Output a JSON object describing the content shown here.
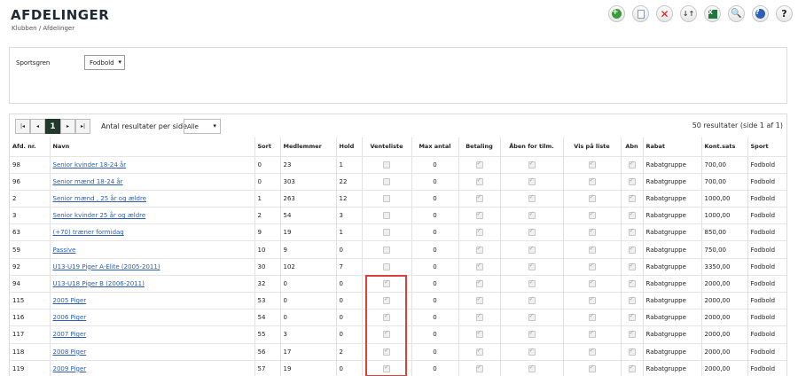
{
  "header": {
    "title": "AFDELINGER",
    "breadcrumb": "Klubben / Afdelinger"
  },
  "toolbar": [
    {
      "name": "add-icon",
      "glyph": "+"
    },
    {
      "name": "document-icon",
      "glyph": ""
    },
    {
      "name": "delete-icon",
      "glyph": "✕"
    },
    {
      "name": "sort-icon",
      "glyph": "↓↑"
    },
    {
      "name": "excel-icon",
      "glyph": "X"
    },
    {
      "name": "search-icon",
      "glyph": "🔍"
    },
    {
      "name": "info-icon",
      "glyph": "?"
    },
    {
      "name": "help-icon",
      "glyph": "?"
    }
  ],
  "filter": {
    "label": "Sportsgren",
    "value": "Fodbold"
  },
  "pager": {
    "first": "|◂",
    "prev": "◂",
    "current": "1",
    "next": "▸",
    "last": "▸|",
    "per_page_label": "Antal resultater per side",
    "per_page_value": "Alle",
    "result_count": "50 resultater (side 1 af 1)"
  },
  "table": {
    "columns": [
      "Afd. nr.",
      "Navn",
      "Sort",
      "Medlemmer",
      "Hold",
      "Venteliste",
      "Max antal",
      "Betaling",
      "Åben for tilm.",
      "Vis på liste",
      "Abn",
      "Rabat",
      "Kont.sats",
      "Sport"
    ],
    "rows": [
      {
        "nr": "98",
        "navn": "Senior kvinder 18-24 år",
        "sort": "0",
        "medlemmer": "23",
        "hold": "1",
        "venteliste": false,
        "max": "0",
        "betaling": true,
        "aaben": true,
        "vis": true,
        "abn": true,
        "rabat": "Rabatgruppe",
        "sats": "700,00",
        "sport": "Fodbold"
      },
      {
        "nr": "96",
        "navn": "Senior mænd 18-24 år",
        "sort": "0",
        "medlemmer": "303",
        "hold": "22",
        "venteliste": false,
        "max": "0",
        "betaling": true,
        "aaben": true,
        "vis": true,
        "abn": true,
        "rabat": "Rabatgruppe",
        "sats": "700,00",
        "sport": "Fodbold"
      },
      {
        "nr": "2",
        "navn": "Senior mænd , 25 år og ældre",
        "sort": "1",
        "medlemmer": "263",
        "hold": "12",
        "venteliste": false,
        "max": "0",
        "betaling": true,
        "aaben": true,
        "vis": true,
        "abn": true,
        "rabat": "Rabatgruppe",
        "sats": "1000,00",
        "sport": "Fodbold"
      },
      {
        "nr": "3",
        "navn": "Senior kvinder 25 år og ældre",
        "sort": "2",
        "medlemmer": "54",
        "hold": "3",
        "venteliste": false,
        "max": "0",
        "betaling": true,
        "aaben": true,
        "vis": true,
        "abn": true,
        "rabat": "Rabatgruppe",
        "sats": "1000,00",
        "sport": "Fodbold"
      },
      {
        "nr": "63",
        "navn": "(+70) træner formidag",
        "sort": "9",
        "medlemmer": "19",
        "hold": "1",
        "venteliste": false,
        "max": "0",
        "betaling": true,
        "aaben": true,
        "vis": true,
        "abn": true,
        "rabat": "Rabatgruppe",
        "sats": "850,00",
        "sport": "Fodbold"
      },
      {
        "nr": "59",
        "navn": "Passive",
        "sort": "10",
        "medlemmer": "9",
        "hold": "0",
        "venteliste": false,
        "max": "0",
        "betaling": true,
        "aaben": true,
        "vis": true,
        "abn": true,
        "rabat": "Rabatgruppe",
        "sats": "750,00",
        "sport": "Fodbold"
      },
      {
        "nr": "92",
        "navn": "U13-U19 Piger A-Elite (2005-2011)",
        "sort": "30",
        "medlemmer": "102",
        "hold": "7",
        "venteliste": false,
        "max": "0",
        "betaling": true,
        "aaben": true,
        "vis": true,
        "abn": true,
        "rabat": "Rabatgruppe",
        "sats": "3350,00",
        "sport": "Fodbold"
      },
      {
        "nr": "94",
        "navn": "U13-U18 Piger B (2006-2011)",
        "sort": "32",
        "medlemmer": "0",
        "hold": "0",
        "venteliste": true,
        "max": "0",
        "betaling": true,
        "aaben": true,
        "vis": true,
        "abn": true,
        "rabat": "Rabatgruppe",
        "sats": "2000,00",
        "sport": "Fodbold"
      },
      {
        "nr": "115",
        "navn": "2005 Piger",
        "sort": "53",
        "medlemmer": "0",
        "hold": "0",
        "venteliste": true,
        "max": "0",
        "betaling": true,
        "aaben": true,
        "vis": true,
        "abn": true,
        "rabat": "Rabatgruppe",
        "sats": "2000,00",
        "sport": "Fodbold"
      },
      {
        "nr": "116",
        "navn": "2006 Piger",
        "sort": "54",
        "medlemmer": "0",
        "hold": "0",
        "venteliste": true,
        "max": "0",
        "betaling": true,
        "aaben": true,
        "vis": true,
        "abn": true,
        "rabat": "Rabatgruppe",
        "sats": "2000,00",
        "sport": "Fodbold"
      },
      {
        "nr": "117",
        "navn": "2007 Piger",
        "sort": "55",
        "medlemmer": "3",
        "hold": "0",
        "venteliste": true,
        "max": "0",
        "betaling": true,
        "aaben": true,
        "vis": true,
        "abn": true,
        "rabat": "Rabatgruppe",
        "sats": "2000,00",
        "sport": "Fodbold"
      },
      {
        "nr": "118",
        "navn": "2008 Piger",
        "sort": "56",
        "medlemmer": "17",
        "hold": "2",
        "venteliste": true,
        "max": "0",
        "betaling": true,
        "aaben": true,
        "vis": true,
        "abn": true,
        "rabat": "Rabatgruppe",
        "sats": "2000,00",
        "sport": "Fodbold"
      },
      {
        "nr": "119",
        "navn": "2009 Piger",
        "sort": "57",
        "medlemmer": "19",
        "hold": "0",
        "venteliste": true,
        "max": "0",
        "betaling": true,
        "aaben": true,
        "vis": true,
        "abn": true,
        "rabat": "Rabatgruppe",
        "sats": "2000,00",
        "sport": "Fodbold"
      }
    ]
  },
  "colors": {
    "highlight": "#d9423c",
    "link": "#2a5db0",
    "pager_active": "#1f3a2a"
  }
}
